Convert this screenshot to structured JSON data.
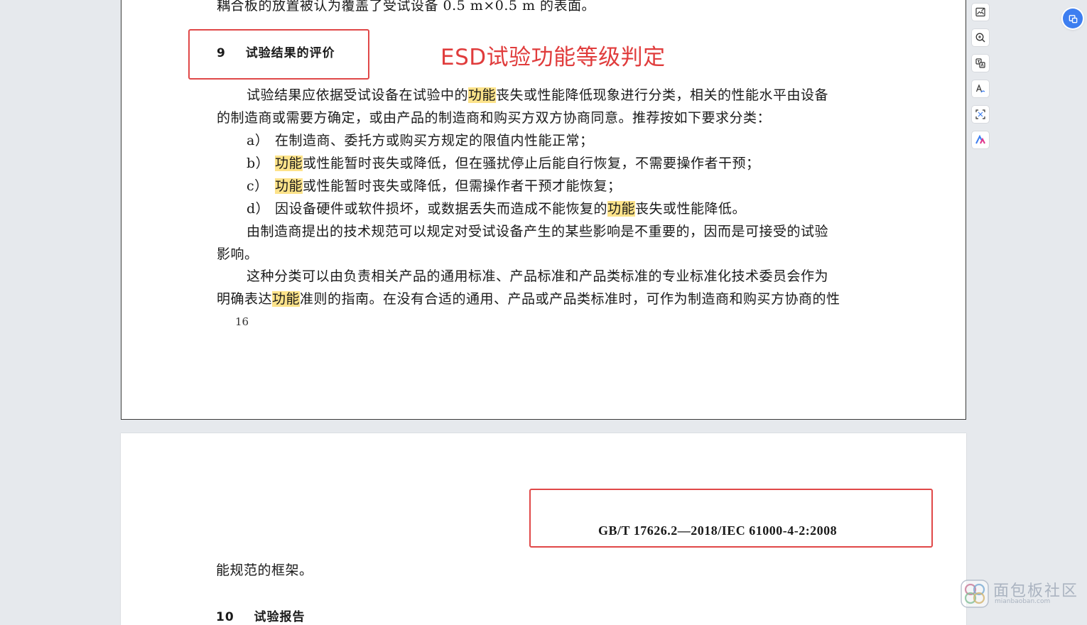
{
  "page1": {
    "top_partial_line": "耦合板的放置被认为覆盖了受试设备 0.5 m×0.5 m 的表面。",
    "section_heading": {
      "number": "9",
      "title": "试验结果的评价"
    },
    "annotation": "ESD试验功能等级判定",
    "para1": {
      "line1": {
        "before": "试验结果应依据受试设备在试验中的",
        "hl": "功能",
        "after": "丧失或性能降低现象进行分类，相关的性能水平由设备"
      },
      "line2": "的制造商或需要方确定，或由产品的制造商和购买方双方协商同意。推荐按如下要求分类："
    },
    "items": [
      {
        "label": "a）",
        "before": "在制造商、委托方或购买方规定的限值内性能正常；",
        "hl": "",
        "after": ""
      },
      {
        "label": "b）",
        "before": "",
        "hl": "功能",
        "after": "或性能暂时丧失或降低，但在骚扰停止后能自行恢复，不需要操作者干预；"
      },
      {
        "label": "c）",
        "before": "",
        "hl": "功能",
        "after": "或性能暂时丧失或降低，但需操作者干预才能恢复；"
      },
      {
        "label": "d）",
        "before": "因设备硬件或软件损坏，或数据丢失而造成不能恢复的",
        "hl": "功能",
        "after": "丧失或性能降低。"
      }
    ],
    "para2": {
      "line1": "由制造商提出的技术规范可以规定对受试设备产生的某些影响是不重要的，因而是可接受的试验",
      "line2": "影响。"
    },
    "para3": {
      "line1": "这种分类可以由负责相关产品的通用标准、产品标准和产品类标准的专业标准化技术委员会作为",
      "line2": {
        "before": "明确表达",
        "hl": "功能",
        "after": "准则的指南。在没有合适的通用、产品或产品类标准时，可作为制造商和购买方协商的性"
      }
    },
    "page_number": "16"
  },
  "page2": {
    "standard_code": "GB/T  17626.2—2018/IEC 61000-4-2:2008",
    "continued_line": "能规范的框架。",
    "next_heading": {
      "number": "10",
      "title": "试验报告"
    }
  },
  "toolbar": {
    "tools": [
      {
        "icon": "image-edit-icon"
      },
      {
        "icon": "zoom-in-icon"
      },
      {
        "icon": "translate-icon"
      },
      {
        "icon": "text-style-icon"
      },
      {
        "icon": "scan-icon"
      },
      {
        "icon": "ai-assistant-icon"
      }
    ]
  },
  "float_button": {
    "icon": "screenshot-icon"
  },
  "watermark": {
    "text": "面包板社区",
    "sub": "mianbaoban.com"
  },
  "colors": {
    "highlight": "#fde38a",
    "annotation_red": "#e03c3c",
    "accent_blue": "#3d7ef0"
  }
}
